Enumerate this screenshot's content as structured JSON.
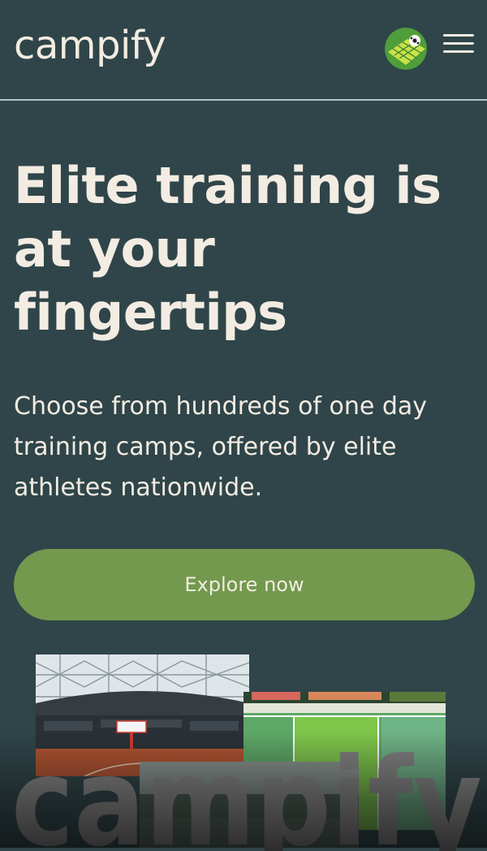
{
  "header": {
    "logo": "campify",
    "avatar_icon": "soccer-field-avatar",
    "menu_icon": "hamburger-menu-icon"
  },
  "hero": {
    "title": "Elite training is at your fingertips",
    "subtitle": "Choose from hundreds of one day training camps, offered by elite athletes nationwide.",
    "cta_label": "Explore now"
  },
  "watermark": {
    "text": "campify"
  },
  "colors": {
    "background": "#2f4549",
    "text": "#f3ece2",
    "cta": "#72994d",
    "divider": "#a9c9c3"
  }
}
